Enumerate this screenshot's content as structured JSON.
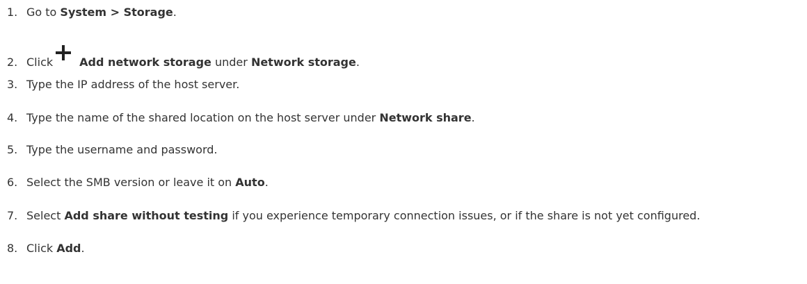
{
  "steps": [
    {
      "num": "1.",
      "t1": "Go to ",
      "b1": "System > Storage",
      "t2": "."
    },
    {
      "num": "2.",
      "t1": "Click",
      "icon": "plus-icon",
      "b1": "Add network storage",
      "t2": " under ",
      "b2": "Network storage",
      "t3": "."
    },
    {
      "num": "3.",
      "t1": "Type the IP address of the host server."
    },
    {
      "num": "4.",
      "t1": "Type the name of the shared location on the host server under ",
      "b1": "Network share",
      "t2": "."
    },
    {
      "num": "5.",
      "t1": "Type the username and password."
    },
    {
      "num": "6.",
      "t1": "Select the SMB version or leave it on ",
      "b1": "Auto",
      "t2": "."
    },
    {
      "num": "7.",
      "t1": "Select ",
      "b1": "Add share without testing",
      "t2": " if you experience temporary connection issues, or if the share is not yet configured."
    },
    {
      "num": "8.",
      "t1": "Click ",
      "b1": "Add",
      "t2": "."
    }
  ]
}
